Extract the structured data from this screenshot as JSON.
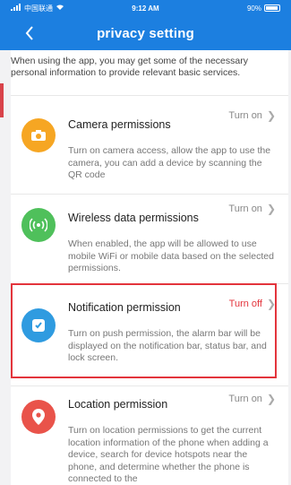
{
  "status_bar": {
    "carrier": "中国联通",
    "time": "9:12 AM",
    "battery": "90%"
  },
  "header": {
    "title": "privacy setting"
  },
  "intro_text": "When using the app, you may get some of the necessary personal information to provide relevant basic services.",
  "items": [
    {
      "title": "Camera permissions",
      "action": "Turn on",
      "description": "Turn on camera access, allow the app to use the camera, you can add a device by scanning the QR code",
      "icon": "camera-icon",
      "icon_color": "#f6a623"
    },
    {
      "title": "Wireless data permissions",
      "action": "Turn on",
      "description": "When enabled, the app will be allowed to use mobile WiFi or mobile data based on the selected permissions.",
      "icon": "wireless-icon",
      "icon_color": "#4fc05b"
    },
    {
      "title": "Notification permission",
      "action": "Turn off",
      "description": "Turn on push permission, the alarm bar will be displayed on the notification bar, status bar, and lock screen.",
      "icon": "notification-icon",
      "icon_color": "#2f9be0"
    },
    {
      "title": "Location permission",
      "action": "Turn on",
      "description": "Turn on location permissions to get the current location information of the phone when adding a device, search for device hotspots near the phone, and determine whether the phone is connected to the",
      "icon": "location-pin-icon",
      "icon_color": "#e9534a"
    }
  ],
  "colors": {
    "header_bg": "#1c7fe0",
    "turn_off": "#e3343c",
    "highlight_border": "#e3343c"
  }
}
